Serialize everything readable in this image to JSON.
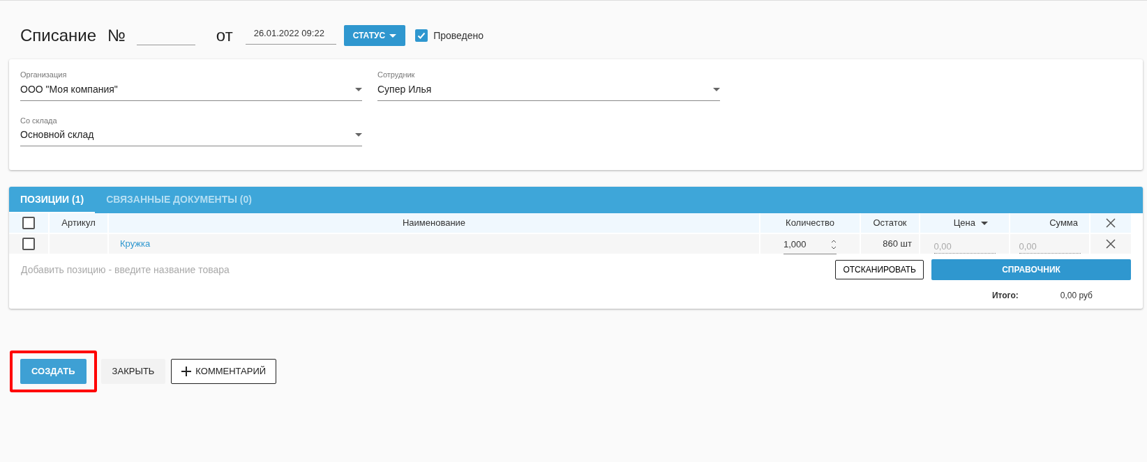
{
  "header": {
    "title": "Списание",
    "number_label": "№",
    "date_label": "от",
    "date": "26.01.2022 09:22",
    "status_button": "СТАТУС",
    "posted": {
      "label": "Проведено",
      "checked": true
    }
  },
  "fields": [
    {
      "label": "Организация",
      "value": "ООО \"Моя компания\""
    },
    {
      "label": "Сотрудник",
      "value": "Супер Илья"
    },
    {
      "label": "Со склада",
      "value": "Основной склад"
    }
  ],
  "tabs": [
    {
      "label": "ПОЗИЦИИ (1)",
      "selected": true
    },
    {
      "label": "СВЯЗАННЫЕ ДОКУМЕНТЫ (0)",
      "selected": false
    }
  ],
  "table": {
    "select_all_checked": false,
    "columns": [
      {
        "kind": "check"
      },
      {
        "kind": "text",
        "label": "Артикул"
      },
      {
        "kind": "text",
        "label": "Наименование"
      },
      {
        "kind": "text",
        "label": "Количество"
      },
      {
        "kind": "text",
        "label": "Остаток"
      },
      {
        "kind": "sort",
        "label": "Цена"
      },
      {
        "kind": "text",
        "label": "Сумма"
      },
      {
        "kind": "remove"
      }
    ],
    "rows": [
      {
        "checked": false,
        "name": "Кружка",
        "quantity": "1,000",
        "stock": "860 шт",
        "price": "0,00",
        "sum": "0,00"
      }
    ]
  },
  "add_placeholder": "Добавить позицию - введите название товара",
  "scan_button": "ОТСКАНИРОВАТЬ",
  "catalog_button": "СПРАВОЧНИК",
  "total": {
    "label": "Итого:",
    "value": "0,00 руб"
  },
  "actions": [
    {
      "label": "СОЗДАТЬ",
      "kind": "primary",
      "highlighted": true
    },
    {
      "label": "ЗАКРЫТЬ",
      "kind": "flat",
      "highlighted": false
    },
    {
      "label": "КОММЕНТАРИЙ",
      "kind": "outline_plus",
      "highlighted": false
    }
  ]
}
